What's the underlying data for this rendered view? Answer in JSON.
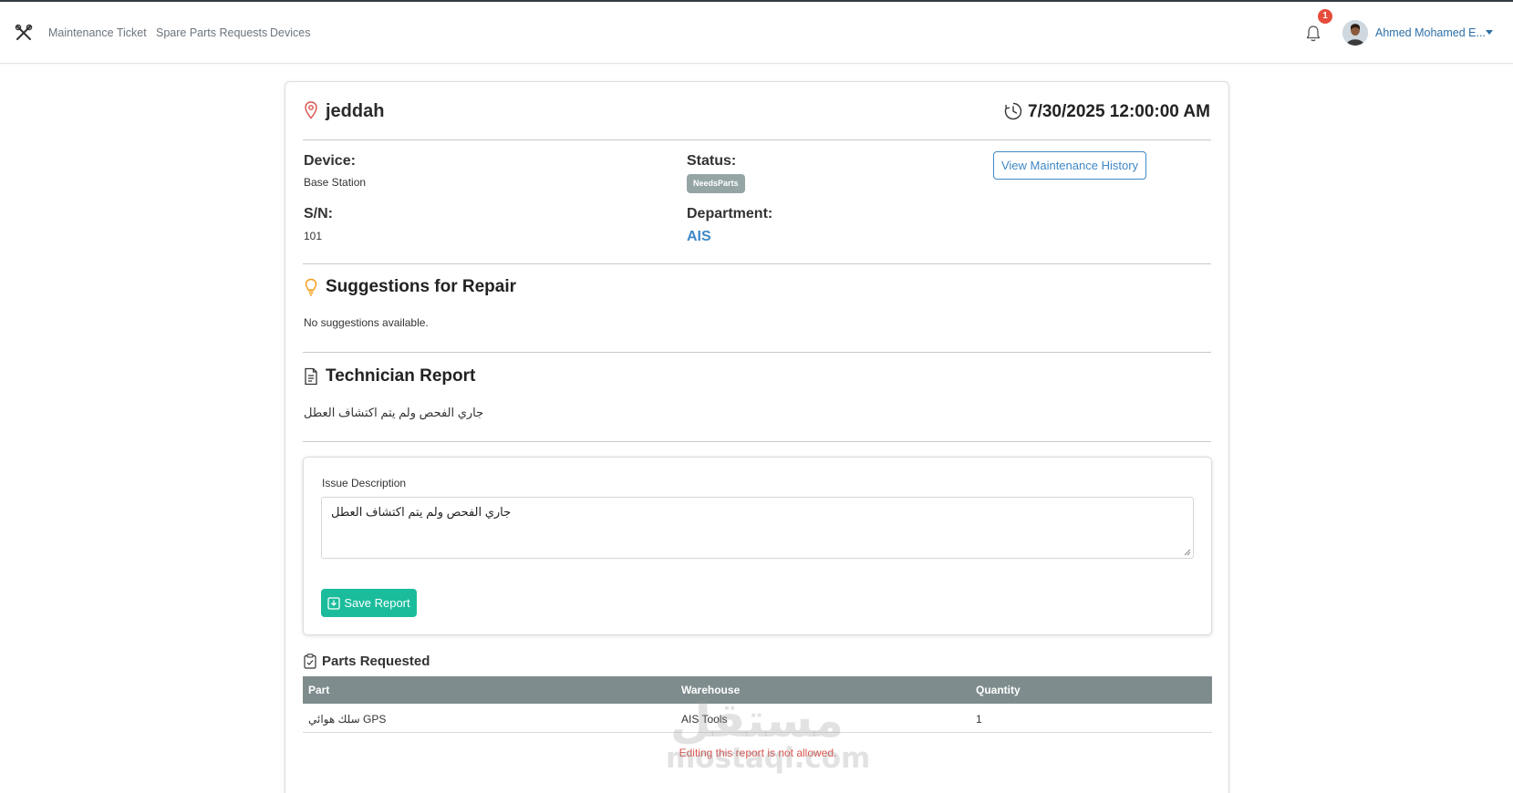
{
  "nav": {
    "links": [
      "Maintenance Ticket",
      "Spare Parts Requests",
      "Devices"
    ],
    "notification_count": "1",
    "user_name": "Ahmed Mohamed E..."
  },
  "ticket": {
    "location": "jeddah",
    "datetime": "7/30/2025 12:00:00 AM",
    "device_label": "Device:",
    "device_value": "Base Station",
    "sn_label": "S/N:",
    "sn_value": "101",
    "status_label": "Status:",
    "status_value": "NeedsParts",
    "department_label": "Department:",
    "department_value": "AIS",
    "history_button": "View Maintenance History"
  },
  "suggestions": {
    "title": "Suggestions for Repair",
    "text": "No suggestions available."
  },
  "technician_report": {
    "title": "Technician Report",
    "text": "جاري الفحص ولم يتم اكتشاف العطل"
  },
  "issue_form": {
    "label": "Issue Description",
    "value": "جاري الفحص ولم يتم اكتشاف العطل",
    "save_button": "Save Report"
  },
  "parts": {
    "title": "Parts Requested",
    "columns": [
      "Part",
      "Warehouse",
      "Quantity"
    ],
    "rows": [
      [
        "سلك هوائي GPS",
        "AIS Tools",
        "1"
      ]
    ],
    "error_message": "Editing this report is not allowed."
  },
  "watermark": {
    "arabic": "مستقل",
    "latin": "mostaqi.com"
  },
  "colors": {
    "accent_blue": "#3f88c5",
    "status_badge": "#95a5a6",
    "save_button": "#1abc9c",
    "table_header": "#7f8c8d",
    "error": "#d9534f",
    "notification": "#e74c3c"
  }
}
